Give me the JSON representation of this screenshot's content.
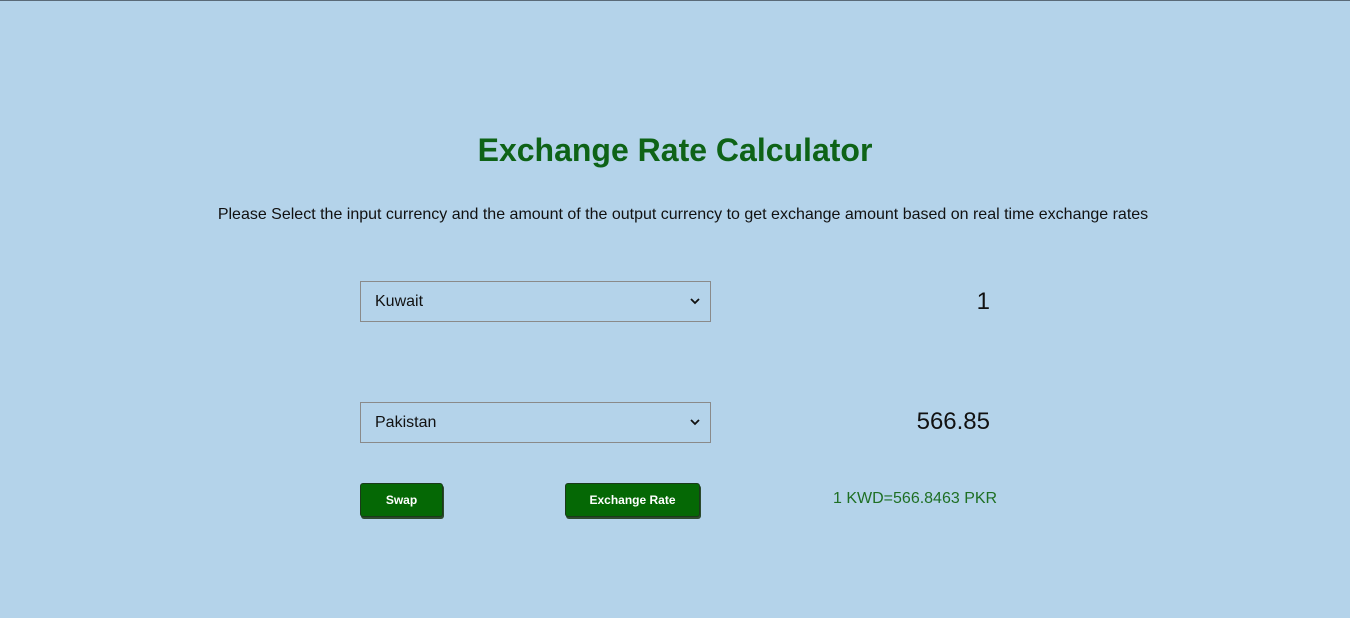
{
  "header": {
    "title": "Exchange Rate Calculator",
    "description": "Please Select the input currency and the amount of the output currency to get exchange amount based on real time exchange rates"
  },
  "converter": {
    "from_currency": "Kuwait",
    "from_amount": "1",
    "to_currency": "Pakistan",
    "to_amount": "566.85"
  },
  "actions": {
    "swap_label": "Swap",
    "exchange_rate_label": "Exchange Rate"
  },
  "result": {
    "rate_text": "1 KWD=566.8463 PKR"
  },
  "icons": {
    "dropdown": "chevron-down-icon"
  },
  "colors": {
    "background": "#b4d3ea",
    "title": "#0e6317",
    "button": "#056805",
    "rate_text": "#1e6f24"
  }
}
